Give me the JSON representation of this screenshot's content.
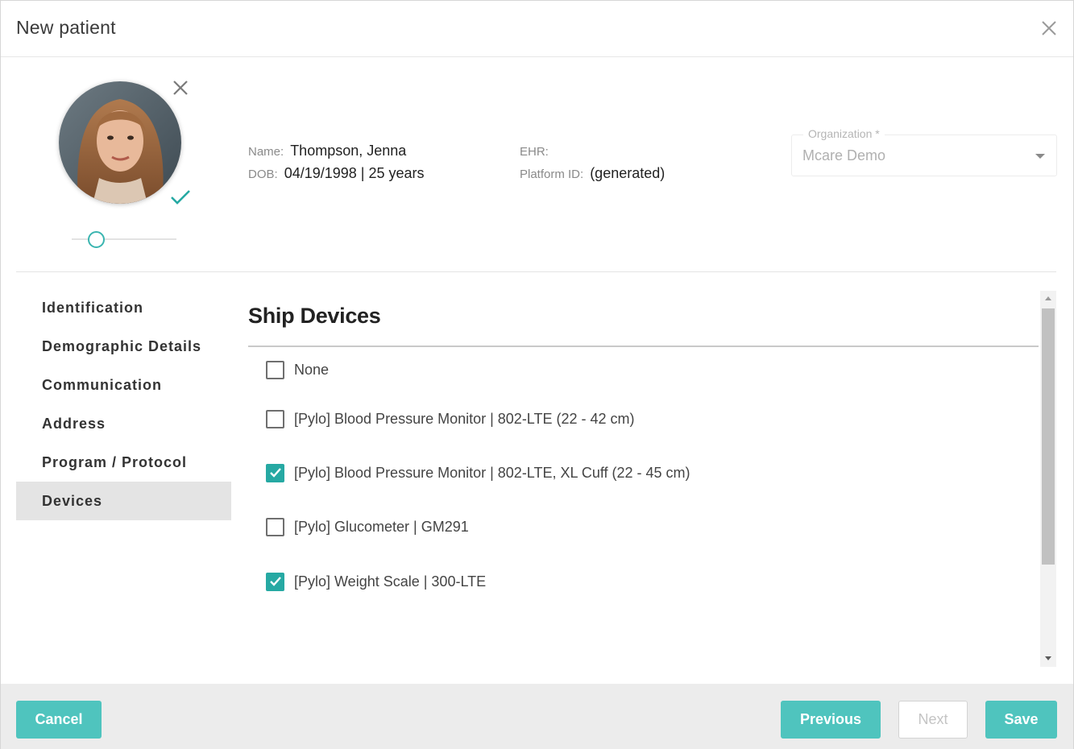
{
  "dialog": {
    "title": "New patient"
  },
  "patient": {
    "name_label": "Name:",
    "name": "Thompson, Jenna",
    "dob_label": "DOB:",
    "dob": "04/19/1998 | 25 years",
    "ehr_label": "EHR:",
    "ehr": "",
    "platform_id_label": "Platform ID:",
    "platform_id": "(generated)",
    "photo_zoom_percent": 15
  },
  "organization": {
    "label": "Organization *",
    "value": "Mcare Demo"
  },
  "nav": {
    "items": [
      {
        "label": "Identification",
        "active": false
      },
      {
        "label": "Demographic Details",
        "active": false
      },
      {
        "label": "Communication",
        "active": false
      },
      {
        "label": "Address",
        "active": false
      },
      {
        "label": "Program / Protocol",
        "active": false
      },
      {
        "label": "Devices",
        "active": true
      }
    ]
  },
  "content": {
    "section_title": "Ship Devices",
    "devices": [
      {
        "label": "None",
        "checked": false
      },
      {
        "label": "[Pylo] Blood Pressure Monitor | 802-LTE (22 - 42 cm)",
        "checked": false
      },
      {
        "label": "[Pylo] Blood Pressure Monitor | 802-LTE, XL Cuff (22 - 45 cm)",
        "checked": true
      },
      {
        "label": "[Pylo] Glucometer | GM291",
        "checked": false
      },
      {
        "label": "[Pylo] Weight Scale | 300-LTE",
        "checked": true
      }
    ]
  },
  "footer": {
    "cancel_label": "Cancel",
    "previous_label": "Previous",
    "next_label": "Next",
    "save_label": "Save"
  },
  "colors": {
    "accent": "#4fc4be",
    "checkbox_checked": "#26a9a3",
    "nav_active_bg": "#e4e4e4"
  },
  "icons": {
    "close": "close-icon",
    "avatar_remove": "close-icon",
    "avatar_confirm": "checkmark-icon",
    "select_caret": "caret-down-icon"
  }
}
